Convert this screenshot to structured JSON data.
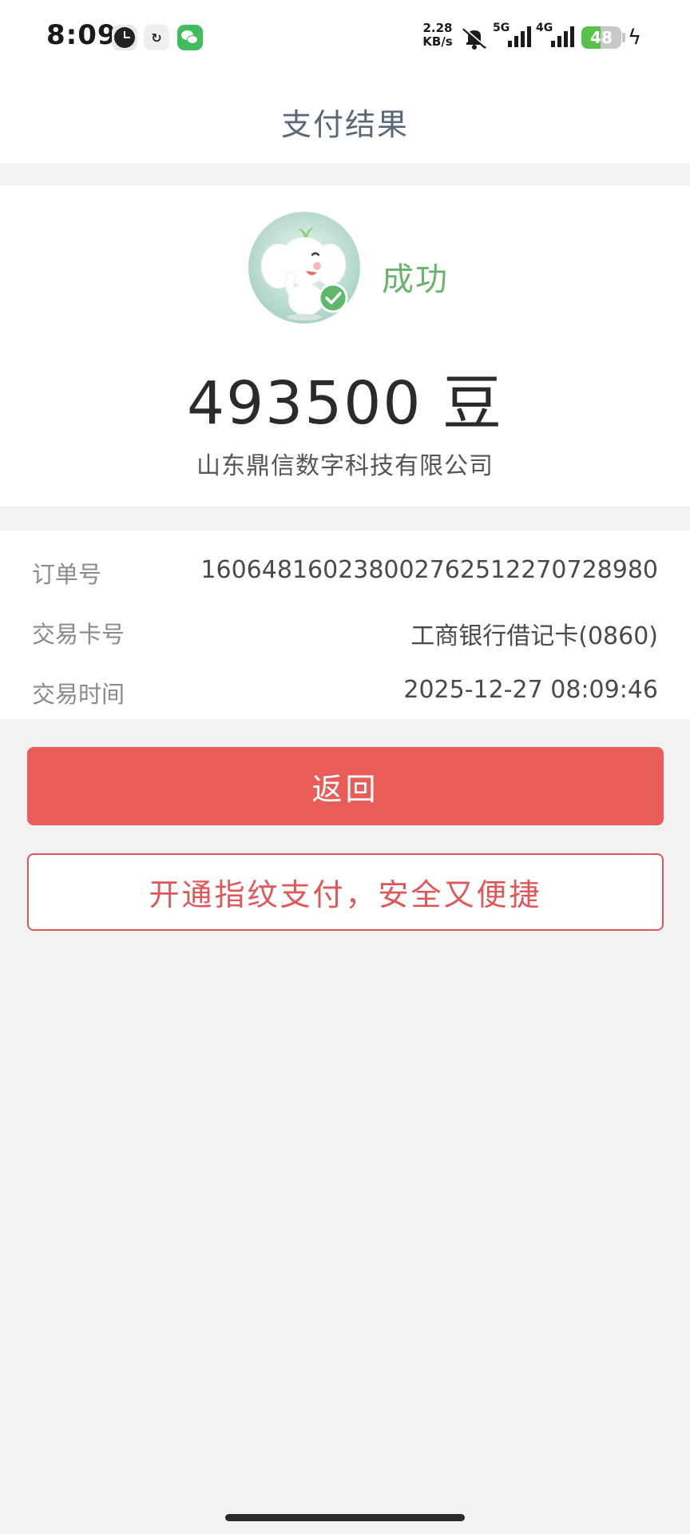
{
  "status_bar": {
    "time": "8:09",
    "net_speed": "2.28",
    "net_speed_unit": "KB/s",
    "sim1_network": "5G",
    "sim2_network": "4G",
    "battery_percent": "48",
    "battery_level": 0.48,
    "charging": true
  },
  "header": {
    "title": "支付结果"
  },
  "result": {
    "status": "成功",
    "amount": "493500 豆",
    "merchant": "山东鼎信数字科技有限公司"
  },
  "details": {
    "order_no_label": "订单号",
    "order_no": "160648160238002762512270728980",
    "card_label": "交易卡号",
    "card": "工商银行借记卡(0860)",
    "time_label": "交易时间",
    "time": "2025-12-27 08:09:46"
  },
  "actions": {
    "back_label": "返回",
    "fingerprint_label": "开通指纹支付，安全又便捷"
  },
  "colors": {
    "accent_red": "#e85d58",
    "success_green": "#6ab36d"
  }
}
